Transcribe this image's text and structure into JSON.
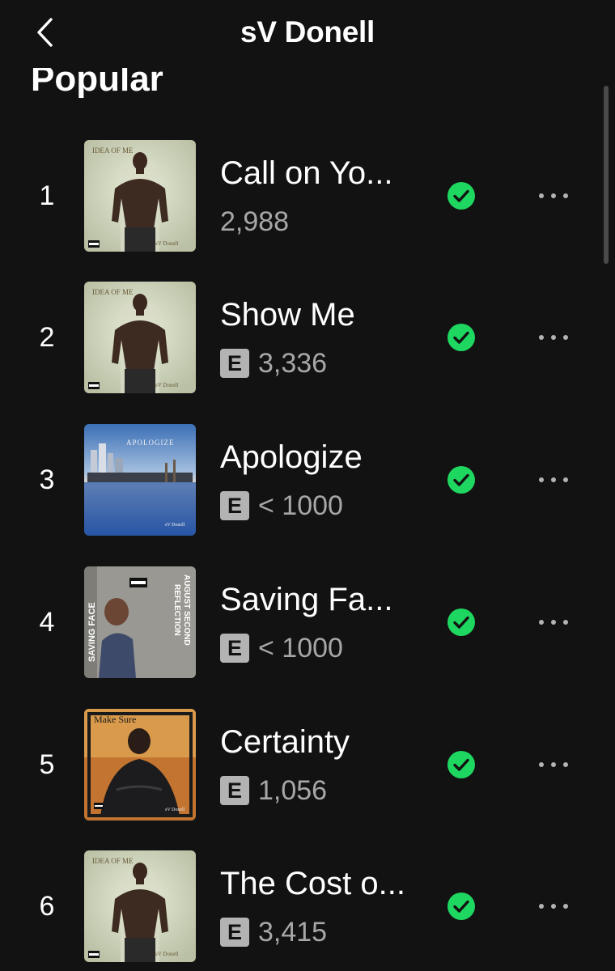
{
  "header": {
    "title": "sV Donell",
    "back_icon": "chevron-left-icon"
  },
  "section": {
    "title": "Popular"
  },
  "colors": {
    "background": "#121212",
    "accent_green": "#1ed760",
    "muted_text": "#a7a7a7"
  },
  "tracks": [
    {
      "rank": "1",
      "title": "Call on Yo...",
      "plays": "2,988",
      "explicit": false,
      "saved": true,
      "cover": "idea-of-me"
    },
    {
      "rank": "2",
      "title": "Show Me",
      "plays": "3,336",
      "explicit": true,
      "saved": true,
      "cover": "idea-of-me"
    },
    {
      "rank": "3",
      "title": "Apologize",
      "plays": "< 1000",
      "explicit": true,
      "saved": true,
      "cover": "apologize"
    },
    {
      "rank": "4",
      "title": "Saving Fa...",
      "plays": "< 1000",
      "explicit": true,
      "saved": true,
      "cover": "saving-face"
    },
    {
      "rank": "5",
      "title": "Certainty",
      "plays": "1,056",
      "explicit": true,
      "saved": true,
      "cover": "make-sure"
    },
    {
      "rank": "6",
      "title": "The Cost o...",
      "plays": "3,415",
      "explicit": true,
      "saved": true,
      "cover": "idea-of-me"
    }
  ],
  "explicit_label": "E",
  "cover_texts": {
    "idea_of_me_title": "IDEA OF ME",
    "idea_of_me_artist": "sV Donell",
    "apologize_title": "APOLOGIZE",
    "apologize_artist": "sV Donell",
    "saving_face_left": "SAVING FACE",
    "saving_face_right_1": "AUGUST SECOND",
    "saving_face_right_2": "REFLECTION",
    "make_sure_title": "Make Sure",
    "make_sure_artist": "sV Donell",
    "advisory": "PARENTAL ADVISORY"
  }
}
